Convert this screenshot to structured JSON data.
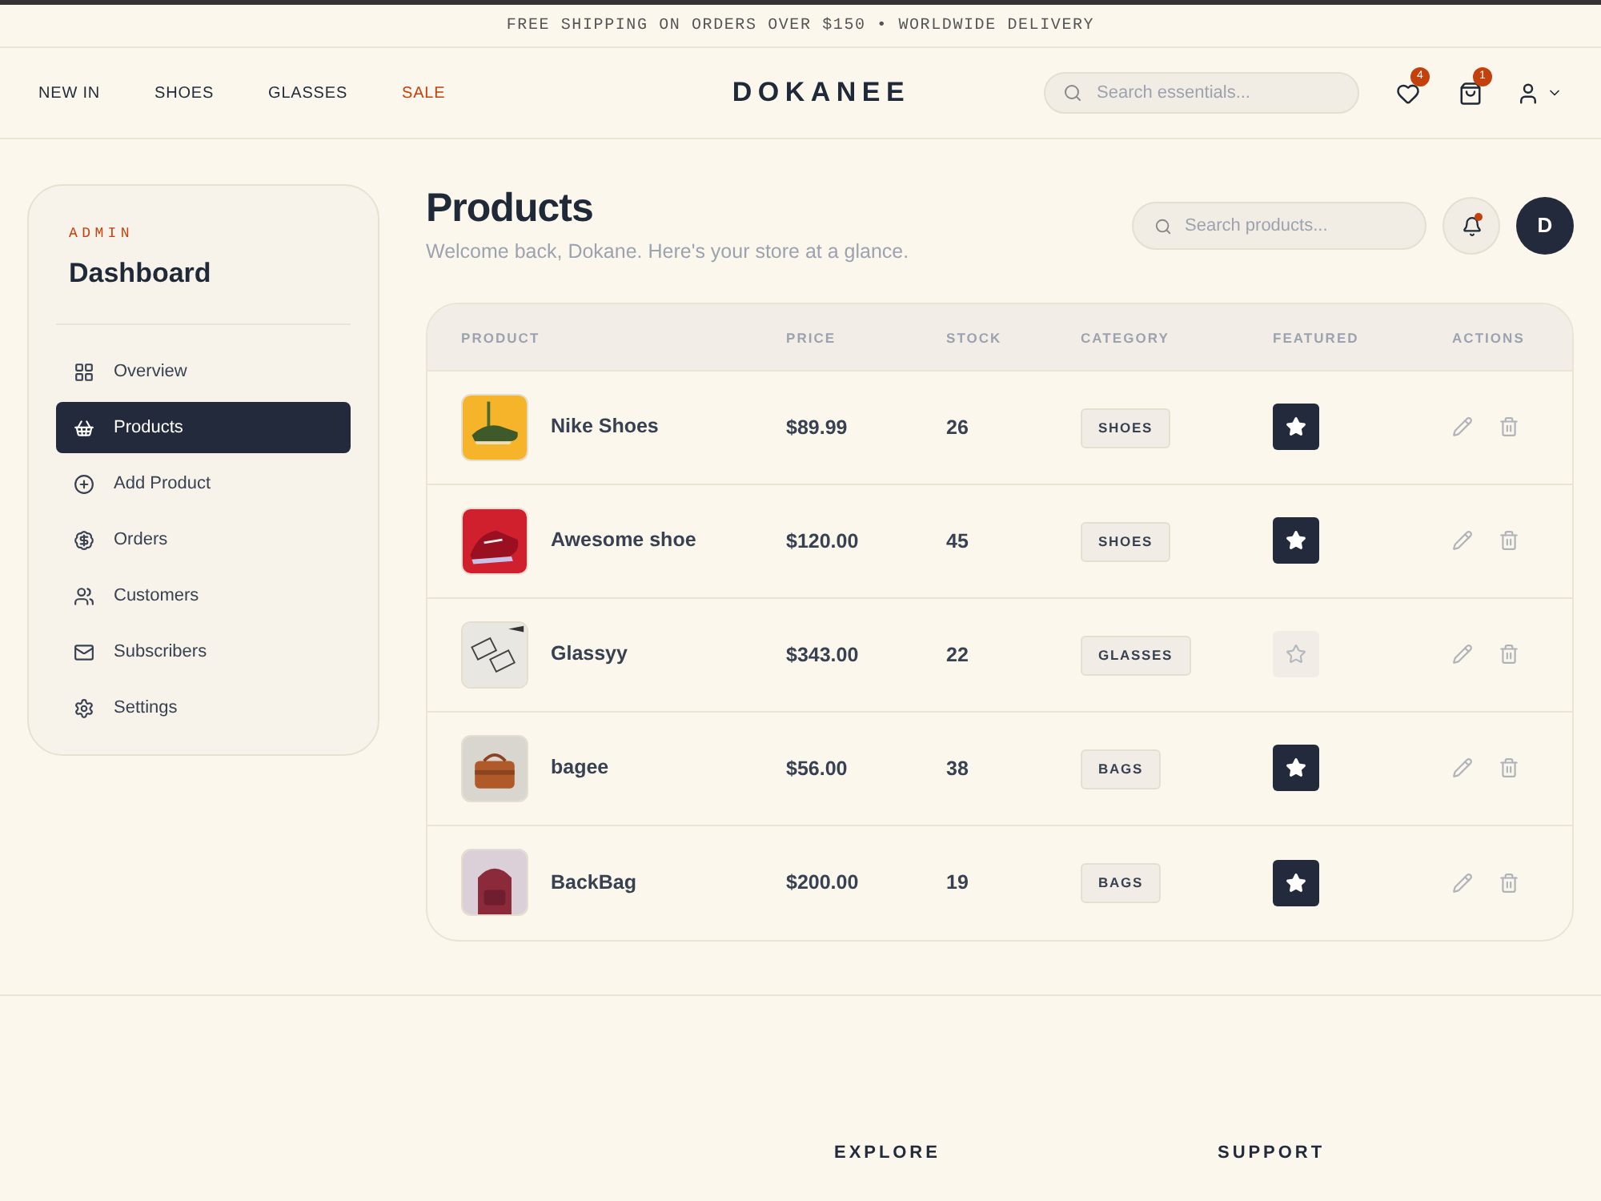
{
  "promo": "FREE SHIPPING ON ORDERS OVER $150 • WORLDWIDE DELIVERY",
  "nav": [
    {
      "label": "NEW IN",
      "kind": "normal"
    },
    {
      "label": "SHOES",
      "kind": "normal"
    },
    {
      "label": "GLASSES",
      "kind": "normal"
    },
    {
      "label": "SALE",
      "kind": "sale"
    }
  ],
  "brand": "DOKANEE",
  "header_search": {
    "placeholder": "Search essentials..."
  },
  "wishlist_count": "4",
  "cart_count": "1",
  "sidebar": {
    "eyebrow": "ADMIN",
    "title": "Dashboard",
    "items": [
      {
        "label": "Overview",
        "selected": false
      },
      {
        "label": "Products",
        "selected": true
      },
      {
        "label": "Add Product",
        "selected": false
      },
      {
        "label": "Orders",
        "selected": false
      },
      {
        "label": "Customers",
        "selected": false
      },
      {
        "label": "Subscribers",
        "selected": false
      },
      {
        "label": "Settings",
        "selected": false
      }
    ]
  },
  "page": {
    "title": "Products",
    "subtitle": "Welcome back, Dokane. Here's your store at a glance.",
    "search": {
      "placeholder": "Search products..."
    },
    "notification": true,
    "avatar": "D"
  },
  "table": {
    "columns": [
      "PRODUCT",
      "PRICE",
      "STOCK",
      "CATEGORY",
      "FEATURED",
      "ACTIONS"
    ],
    "rows": [
      {
        "name": "Nike Shoes",
        "price": "$89.99",
        "stock": "26",
        "category": "SHOES",
        "featured": true
      },
      {
        "name": "Awesome shoe",
        "price": "$120.00",
        "stock": "45",
        "category": "SHOES",
        "featured": true
      },
      {
        "name": "Glassyy",
        "price": "$343.00",
        "stock": "22",
        "category": "GLASSES",
        "featured": false
      },
      {
        "name": "bagee",
        "price": "$56.00",
        "stock": "38",
        "category": "BAGS",
        "featured": true
      },
      {
        "name": "BackBag",
        "price": "$200.00",
        "stock": "19",
        "category": "BAGS",
        "featured": true
      }
    ]
  },
  "footer": {
    "columns": [
      "EXPLORE",
      "SUPPORT"
    ]
  }
}
